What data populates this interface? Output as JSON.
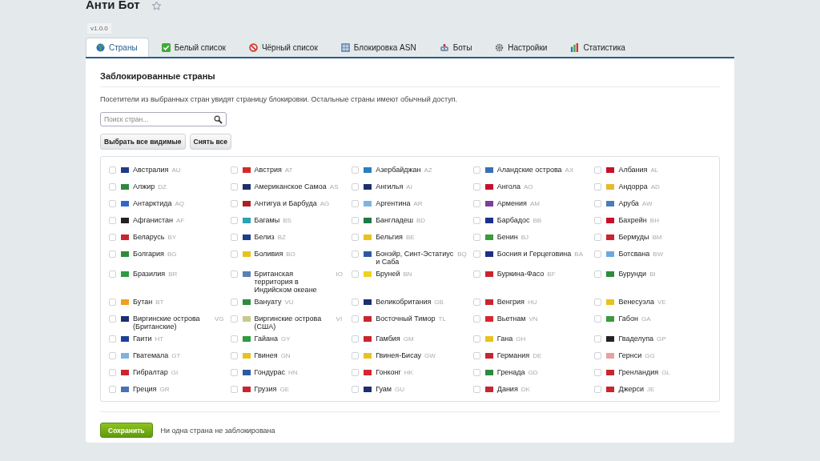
{
  "header": {
    "title": "Анти Бот",
    "favorite": false,
    "version": "v1.0.0"
  },
  "tabs": [
    {
      "label": "Страны",
      "kind": "globe",
      "selected": true
    },
    {
      "label": "Белый список",
      "kind": "check",
      "selected": false
    },
    {
      "label": "Чёрный список",
      "kind": "ban",
      "selected": false
    },
    {
      "label": "Блокировка ASN",
      "kind": "asn",
      "selected": false
    },
    {
      "label": "Боты",
      "kind": "bot",
      "selected": false
    },
    {
      "label": "Настройки",
      "kind": "gear",
      "selected": false
    },
    {
      "label": "Статистика",
      "kind": "chart",
      "selected": false
    }
  ],
  "panel": {
    "heading": "Заблокированные страны",
    "description": "Посетители из выбранных стран увидят страницу блокировки. Остальные страны имеют обычный доступ.",
    "search": {
      "placeholder": "Поиск стран..."
    },
    "buttons": [
      "Выбрать все видимые",
      "Снять все"
    ],
    "countries": [
      {
        "name": "Австралия",
        "code": "AU",
        "checked": false,
        "color": "#1f3a8a"
      },
      {
        "name": "Австрия",
        "code": "AT",
        "checked": false,
        "color": "#d62828"
      },
      {
        "name": "Азербайджан",
        "code": "AZ",
        "checked": false,
        "color": "#2a7fc1"
      },
      {
        "name": "Аландские острова",
        "code": "AX",
        "checked": false,
        "color": "#3a6fb5"
      },
      {
        "name": "Албания",
        "code": "AL",
        "checked": false,
        "color": "#c8102e"
      },
      {
        "name": "Алжир",
        "code": "DZ",
        "checked": false,
        "color": "#2e8b3e"
      },
      {
        "name": "Американское Самоа",
        "code": "AS",
        "checked": false,
        "color": "#1c2f6e"
      },
      {
        "name": "Ангилья",
        "code": "AI",
        "checked": false,
        "color": "#1c2f6e"
      },
      {
        "name": "Ангола",
        "code": "AO",
        "checked": false,
        "color": "#c8102e"
      },
      {
        "name": "Андорра",
        "code": "AD",
        "checked": false,
        "color": "#e8b92d"
      },
      {
        "name": "Антарктида",
        "code": "AQ",
        "checked": false,
        "color": "#3366cc"
      },
      {
        "name": "Антигуа и Барбуда",
        "code": "AG",
        "checked": false,
        "color": "#b01e23"
      },
      {
        "name": "Аргентина",
        "code": "AR",
        "checked": false,
        "color": "#7fb3e0"
      },
      {
        "name": "Армения",
        "code": "AM",
        "checked": false,
        "color": "#7a3e9d"
      },
      {
        "name": "Аруба",
        "code": "AW",
        "checked": false,
        "color": "#4a7db8"
      },
      {
        "name": "Афганистан",
        "code": "AF",
        "checked": false,
        "color": "#222222"
      },
      {
        "name": "Багамы",
        "code": "BS",
        "checked": false,
        "color": "#2aa3b5"
      },
      {
        "name": "Бангладеш",
        "code": "BD",
        "checked": false,
        "color": "#1e7a45"
      },
      {
        "name": "Барбадос",
        "code": "BB",
        "checked": false,
        "color": "#1c2f8a"
      },
      {
        "name": "Бахрейн",
        "code": "BH",
        "checked": false,
        "color": "#c8102e"
      },
      {
        "name": "Беларусь",
        "code": "BY",
        "checked": false,
        "color": "#c8262e"
      },
      {
        "name": "Белиз",
        "code": "BZ",
        "checked": false,
        "color": "#1c3f8a"
      },
      {
        "name": "Бельгия",
        "code": "BE",
        "checked": false,
        "color": "#e8c21d"
      },
      {
        "name": "Бенин",
        "code": "BJ",
        "checked": false,
        "color": "#3a9a3e"
      },
      {
        "name": "Бермуды",
        "code": "BM",
        "checked": false,
        "color": "#c8262e"
      },
      {
        "name": "Болгария",
        "code": "BG",
        "checked": false,
        "color": "#2e8b3e"
      },
      {
        "name": "Боливия",
        "code": "BO",
        "checked": false,
        "color": "#e8c21d"
      },
      {
        "name": "Бонэйр, Синт-Эстатиус и Саба",
        "code": "BQ",
        "checked": false,
        "color": "#2c5aa0"
      },
      {
        "name": "Босния и Герцеговина",
        "code": "BA",
        "checked": false,
        "color": "#1c2f8a"
      },
      {
        "name": "Ботсвана",
        "code": "BW",
        "checked": false,
        "color": "#6fa8dc"
      },
      {
        "name": "Бразилия",
        "code": "BR",
        "checked": false,
        "color": "#2e9b3e"
      },
      {
        "name": "Британская территория в Индийском океане",
        "code": "IO",
        "checked": false,
        "color": "#5b7fb8"
      },
      {
        "name": "Бруней",
        "code": "BN",
        "checked": false,
        "color": "#f0d020"
      },
      {
        "name": "Буркина-Фасо",
        "code": "BF",
        "checked": false,
        "color": "#c8262e"
      },
      {
        "name": "Бурунди",
        "code": "BI",
        "checked": false,
        "color": "#2e8b3e"
      },
      {
        "name": "Бутан",
        "code": "BT",
        "checked": false,
        "color": "#f0a020"
      },
      {
        "name": "Вануату",
        "code": "VU",
        "checked": false,
        "color": "#2e8b3e"
      },
      {
        "name": "Великобритания",
        "code": "GB",
        "checked": false,
        "color": "#1c2f6e"
      },
      {
        "name": "Венгрия",
        "code": "HU",
        "checked": false,
        "color": "#c8262e"
      },
      {
        "name": "Венесуэла",
        "code": "VE",
        "checked": false,
        "color": "#e8c21d"
      },
      {
        "name": "Виргинские острова (Британские)",
        "code": "VG",
        "checked": false,
        "color": "#1c2f6e"
      },
      {
        "name": "Виргинские острова (США)",
        "code": "VI",
        "checked": false,
        "color": "#c9c98a"
      },
      {
        "name": "Восточный Тимор",
        "code": "TL",
        "checked": false,
        "color": "#c8262e"
      },
      {
        "name": "Вьетнам",
        "code": "VN",
        "checked": false,
        "color": "#d8262e"
      },
      {
        "name": "Габон",
        "code": "GA",
        "checked": false,
        "color": "#3a9a3e"
      },
      {
        "name": "Гаити",
        "code": "HT",
        "checked": false,
        "color": "#1c3f9a"
      },
      {
        "name": "Гайана",
        "code": "GY",
        "checked": false,
        "color": "#2e9b3e"
      },
      {
        "name": "Гамбия",
        "code": "GM",
        "checked": false,
        "color": "#c8262e"
      },
      {
        "name": "Гана",
        "code": "GH",
        "checked": false,
        "color": "#e8c21d"
      },
      {
        "name": "Гваделупа",
        "code": "GP",
        "checked": false,
        "color": "#222222"
      },
      {
        "name": "Гватемала",
        "code": "GT",
        "checked": false,
        "color": "#7fb3e0"
      },
      {
        "name": "Гвинея",
        "code": "GN",
        "checked": false,
        "color": "#e8c21d"
      },
      {
        "name": "Гвинея-Бисау",
        "code": "GW",
        "checked": false,
        "color": "#e8c21d"
      },
      {
        "name": "Германия",
        "code": "DE",
        "checked": false,
        "color": "#c8262e"
      },
      {
        "name": "Гернси",
        "code": "GG",
        "checked": false,
        "color": "#e8a0a0"
      },
      {
        "name": "Гибралтар",
        "code": "GI",
        "checked": false,
        "color": "#c8262e"
      },
      {
        "name": "Гондурас",
        "code": "HN",
        "checked": false,
        "color": "#2c5aa0"
      },
      {
        "name": "Гонконг",
        "code": "HK",
        "checked": false,
        "color": "#d8262e"
      },
      {
        "name": "Гренада",
        "code": "GD",
        "checked": false,
        "color": "#2e8b3e"
      },
      {
        "name": "Гренландия",
        "code": "GL",
        "checked": false,
        "color": "#c8262e"
      },
      {
        "name": "Греция",
        "code": "GR",
        "checked": false,
        "color": "#4a6fb8"
      },
      {
        "name": "Грузия",
        "code": "GE",
        "checked": false,
        "color": "#c8262e"
      },
      {
        "name": "Гуам",
        "code": "GU",
        "checked": false,
        "color": "#1c2f6e"
      },
      {
        "name": "Дания",
        "code": "DK",
        "checked": false,
        "color": "#c8262e"
      },
      {
        "name": "Джерси",
        "code": "JE",
        "checked": false,
        "color": "#c8262e"
      }
    ],
    "save_button": "Сохранить",
    "status": "Ни одна страна не заблокирована"
  }
}
